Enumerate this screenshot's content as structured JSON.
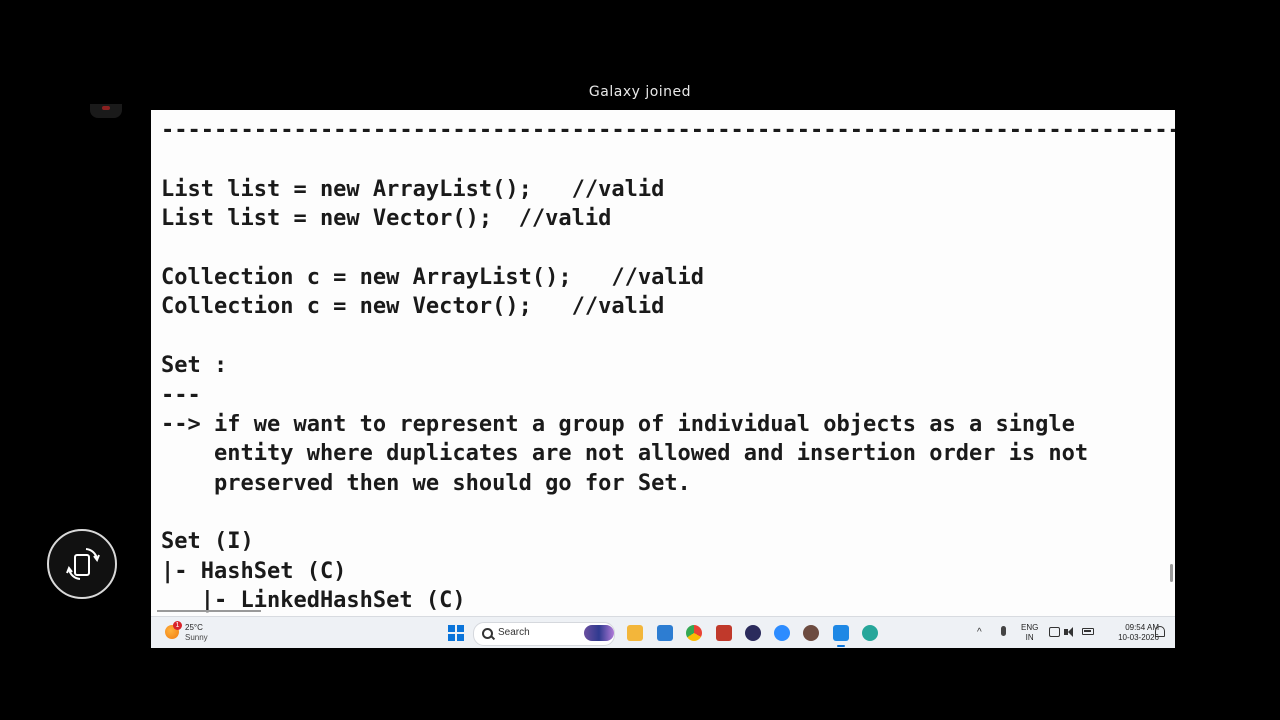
{
  "notification": {
    "text": "Galaxy joined"
  },
  "editor": {
    "lines": [
      "---------------------------------------------------------------------------------------------",
      "",
      "List list = new ArrayList();   //valid",
      "List list = new Vector();  //valid",
      "",
      "Collection c = new ArrayList();   //valid",
      "Collection c = new Vector();   //valid",
      "",
      "Set :",
      "---",
      "--> if we want to represent a group of individual objects as a single",
      "    entity where duplicates are not allowed and insertion order is not",
      "    preserved then we should go for Set.",
      "",
      "Set (I)",
      "|- HashSet (C)",
      "   |- LinkedHashSet (C)"
    ]
  },
  "taskbar": {
    "weather": {
      "temperature": "25°C",
      "condition": "Sunny",
      "badge": "1"
    },
    "search_placeholder": "Search",
    "language": {
      "line1": "ENG",
      "line2": "IN"
    },
    "clock": {
      "time": "09:54 AM",
      "date": "10-03-2026"
    },
    "app_icons": [
      {
        "name": "file-explorer-icon",
        "color": "#f3b63a"
      },
      {
        "name": "remote-desktop-icon",
        "color": "#2d7dd2"
      },
      {
        "name": "chrome-icon",
        "color": "#e94235"
      },
      {
        "name": "settings-app-icon",
        "color": "#c0392b"
      },
      {
        "name": "media-player-icon",
        "color": "#2b2b5c"
      },
      {
        "name": "zoom-icon",
        "color": "#2d8cff"
      },
      {
        "name": "browser-icon",
        "color": "#6d4c41"
      },
      {
        "name": "notepad-icon",
        "color": "#1e88e5"
      },
      {
        "name": "network-app-icon",
        "color": "#26a69a"
      }
    ]
  }
}
